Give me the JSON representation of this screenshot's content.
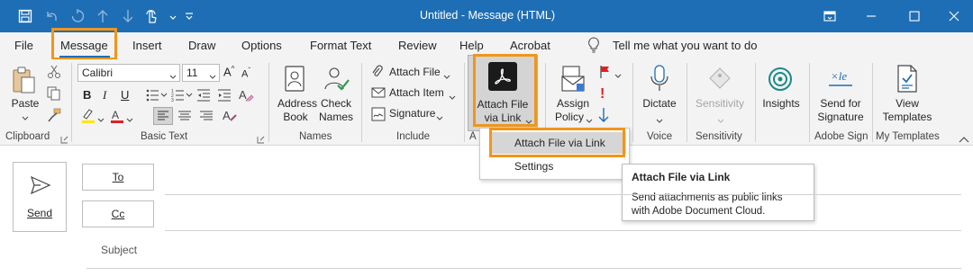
{
  "title_bar": {
    "title": "Untitled  -  Message (HTML)",
    "bg_color": "#1e6eb5",
    "icons": [
      "save-icon",
      "undo-icon",
      "redo-icon",
      "up-icon",
      "down-icon",
      "touch-mode-icon",
      "customize-qat-icon"
    ],
    "window_controls": [
      "ribbon-display-icon",
      "minimize-icon",
      "maximize-icon",
      "close-icon"
    ]
  },
  "menu": {
    "tabs": [
      "File",
      "Message",
      "Insert",
      "Draw",
      "Options",
      "Format Text",
      "Review",
      "Help",
      "Acrobat"
    ],
    "active_tab": "Message",
    "tell_me": "Tell me what you want to do"
  },
  "ribbon": {
    "clipboard": {
      "paste": "Paste",
      "group": "Clipboard"
    },
    "basic_text": {
      "font": "Calibri",
      "size": "11",
      "bold": "B",
      "italic": "I",
      "underline": "U",
      "group": "Basic Text"
    },
    "names": {
      "address_book_1": "Address",
      "address_book_2": "Book",
      "check_names_1": "Check",
      "check_names_2": "Names",
      "group": "Names"
    },
    "include": {
      "attach_file": "Attach File",
      "attach_item": "Attach Item",
      "signature": "Signature",
      "group": "Include"
    },
    "acrobat": {
      "label_1": "Attach File",
      "label_2": "via Link",
      "group_fragment": "A"
    },
    "tags": {
      "assign_1": "Assign",
      "assign_2": "Policy"
    },
    "voice": {
      "dictate": "Dictate",
      "group": "Voice"
    },
    "sensitivity": {
      "label": "Sensitivity",
      "group": "Sensitivity"
    },
    "insights": {
      "label": "Insights"
    },
    "adobe_sign": {
      "label_1": "Send for",
      "label_2": "Signature",
      "group": "Adobe Sign"
    },
    "templates": {
      "label_1": "View",
      "label_2": "Templates",
      "group": "My Templates"
    }
  },
  "dropdown": {
    "items": [
      "Attach File via Link",
      "Settings"
    ],
    "highlighted": "Attach File via Link"
  },
  "tooltip": {
    "title": "Attach File via Link",
    "body_1": "Send attachments as public links",
    "body_2": "with Adobe Document Cloud."
  },
  "compose": {
    "send": "Send",
    "to": "To",
    "cc": "Cc",
    "subject": "Subject"
  },
  "colors": {
    "highlight": "#f0961c",
    "accent": "#1e6eb5",
    "ribbon_bg": "#f3f3f3"
  }
}
